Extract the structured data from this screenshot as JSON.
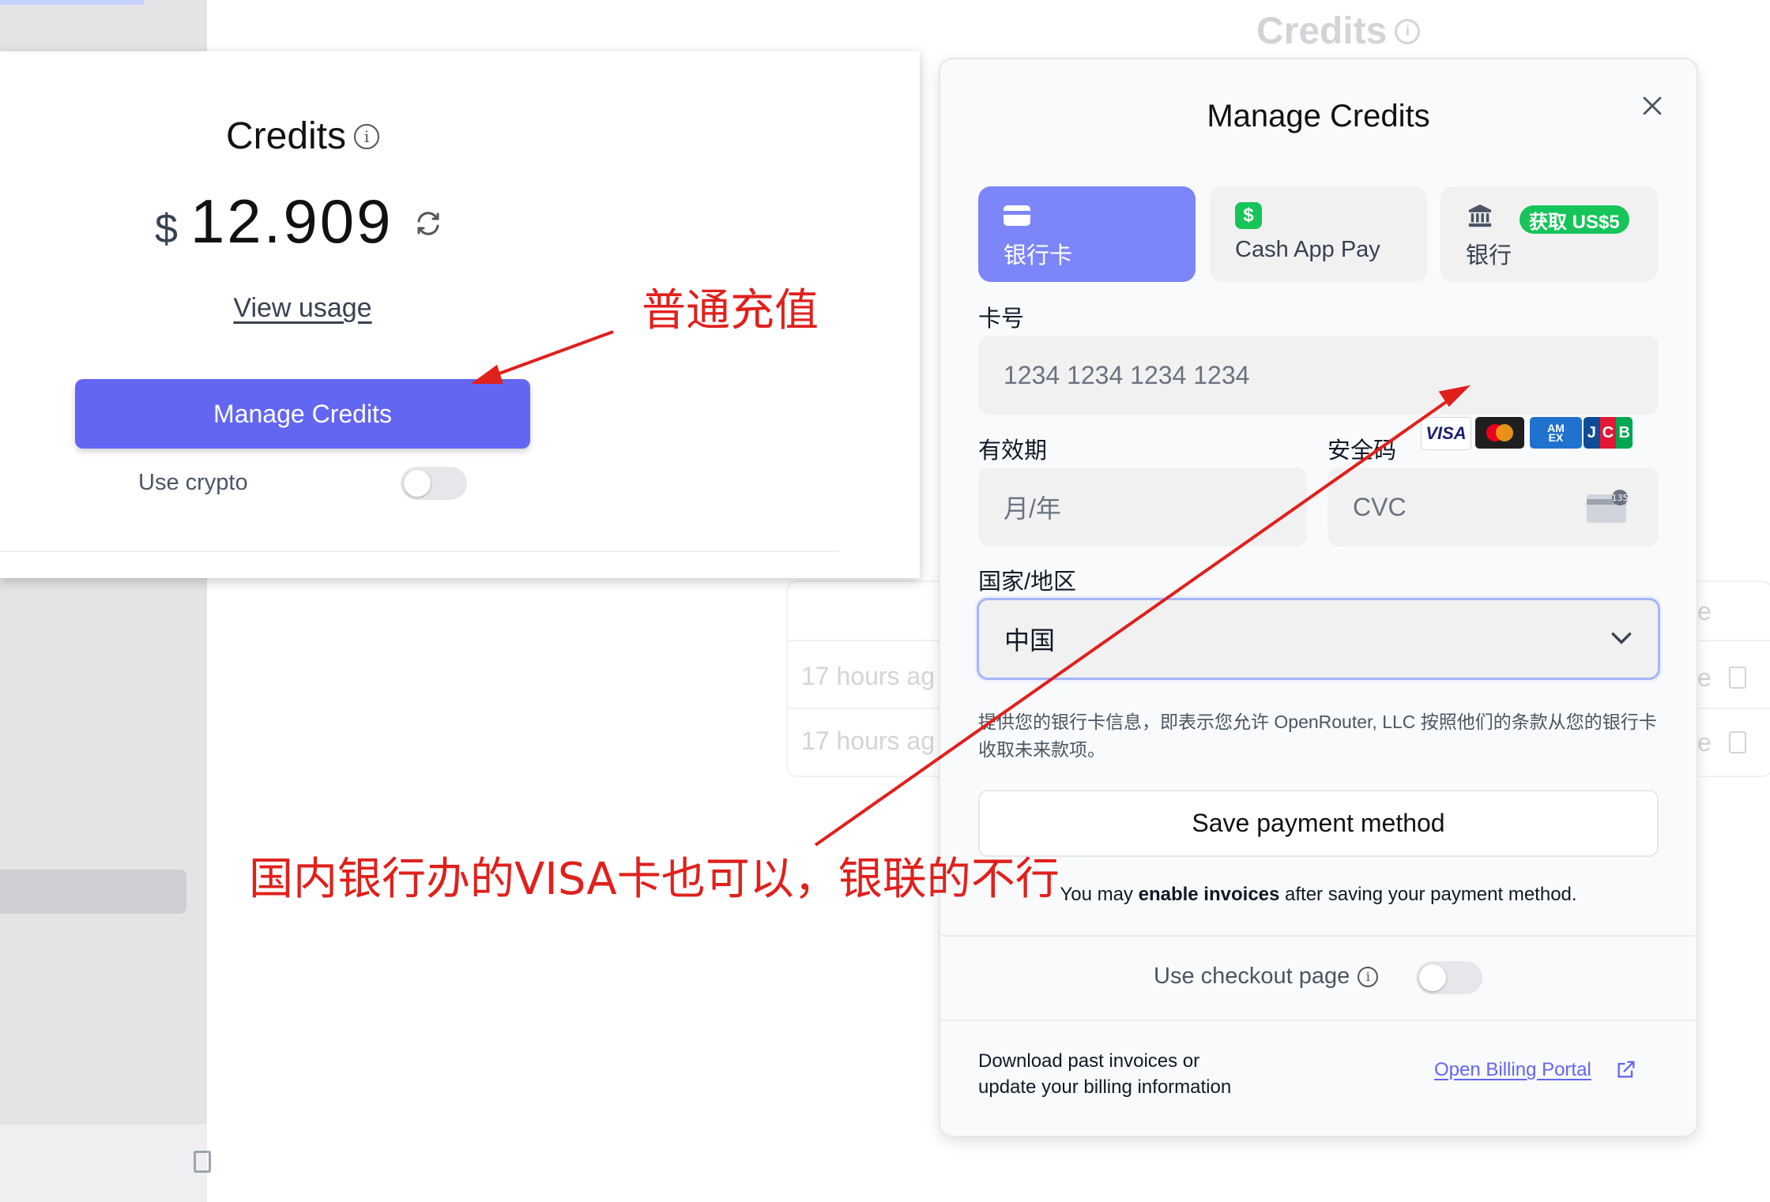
{
  "background": {
    "page_title": "Credits",
    "rows": [
      {
        "time": "17 hours ag",
        "status": "e"
      },
      {
        "time": "17 hours ag",
        "status": "e"
      }
    ],
    "header_right": "e"
  },
  "credits_card": {
    "title": "Credits",
    "currency": "$",
    "balance": "12.909",
    "view_usage": "View usage",
    "manage_button": "Manage Credits",
    "use_crypto_label": "Use crypto",
    "use_crypto_enabled": false
  },
  "modal": {
    "title": "Manage Credits",
    "tabs": [
      {
        "label": "银行卡",
        "icon": "credit-card-icon",
        "active": true
      },
      {
        "label": "Cash App Pay",
        "icon": "cash-app-icon",
        "active": false
      },
      {
        "label": "银行",
        "icon": "bank-icon",
        "active": false,
        "badge": "获取 US$5"
      }
    ],
    "card_number": {
      "label": "卡号",
      "placeholder": "1234 1234 1234 1234",
      "brands": [
        "VISA",
        "Mastercard",
        "AMEX",
        "JCB"
      ]
    },
    "expiry": {
      "label": "有效期",
      "placeholder": "月/年"
    },
    "cvc": {
      "label": "安全码",
      "placeholder": "CVC",
      "icon_text": "135"
    },
    "country": {
      "label": "国家/地区",
      "value": "中国"
    },
    "consent": "提供您的银行卡信息，即表示您允许 OpenRouter, LLC 按照他们的条款从您的银行卡收取未来款项。",
    "save_button": "Save payment method",
    "invoice_note_prefix": "You may ",
    "invoice_note_bold": "enable invoices",
    "invoice_note_suffix": " after saving your payment method.",
    "checkout_label": "Use checkout page",
    "checkout_enabled": false,
    "download_line1": "Download past invoices or",
    "download_line2": "update your billing information",
    "billing_portal_link": "Open Billing Portal"
  },
  "annotations": {
    "top": "普通充值",
    "bottom": "国内银行办的VISA卡也可以，银联的不行"
  },
  "colors": {
    "accent": "#6366f1",
    "active_tab": "#7c86f8",
    "badge_green": "#16c45a",
    "annotation_red": "#e0201c"
  }
}
